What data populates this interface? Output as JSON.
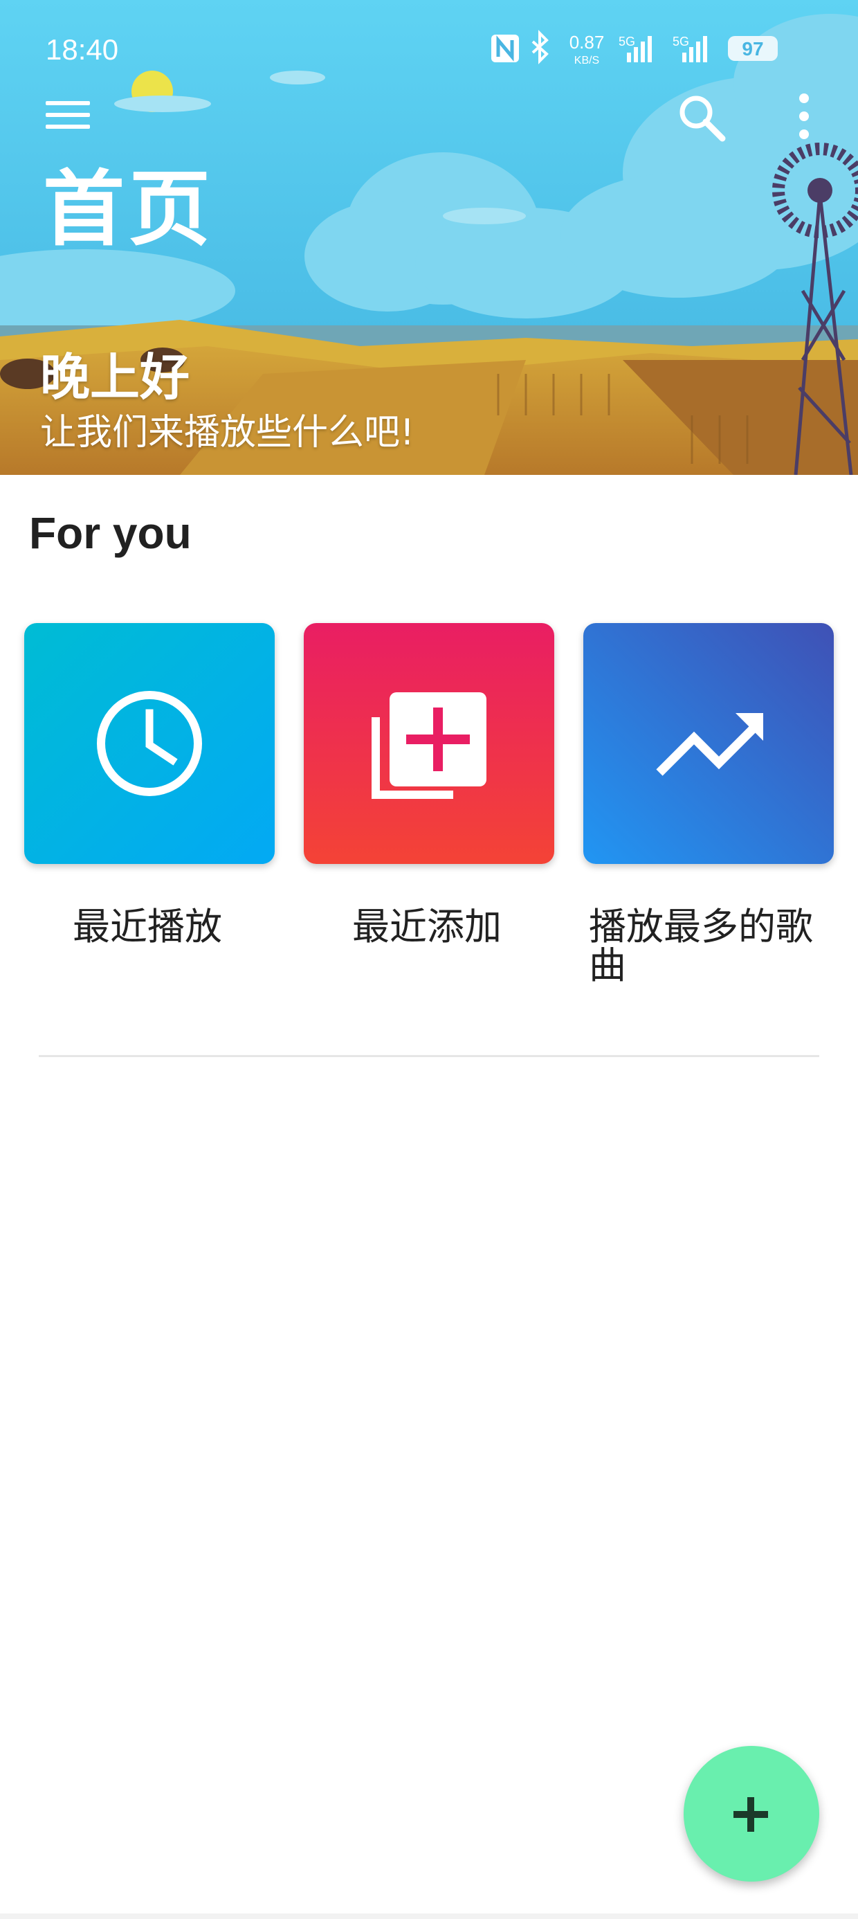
{
  "status_bar": {
    "time": "18:40",
    "net_speed": "0.87",
    "net_speed_unit": "KB/S",
    "signal_1": "5G",
    "signal_2": "5G",
    "battery": "97",
    "icons": [
      "nfc-icon",
      "bluetooth-icon",
      "signal-icon",
      "battery-icon"
    ]
  },
  "toolbar": {
    "menu_icon": "menu-icon",
    "search_icon": "search-icon",
    "more_icon": "more-vert-icon"
  },
  "header": {
    "title": "首页",
    "greeting": "晚上好",
    "subtitle": "让我们来播放些什么吧!"
  },
  "section": {
    "title": "For you"
  },
  "cards": [
    {
      "label": "最近播放",
      "icon": "clock-icon",
      "colors": [
        "#00bcd4",
        "#03a9f4"
      ]
    },
    {
      "label": "最近添加",
      "icon": "library-add-icon",
      "colors": [
        "#e91e63",
        "#f44336"
      ]
    },
    {
      "label_line1": "播放最多的歌",
      "label_line2": "曲",
      "icon": "trending-up-icon",
      "colors": [
        "#3f51b5",
        "#2196f3"
      ]
    }
  ],
  "fab": {
    "icon": "add-icon",
    "color": "#69efae"
  }
}
